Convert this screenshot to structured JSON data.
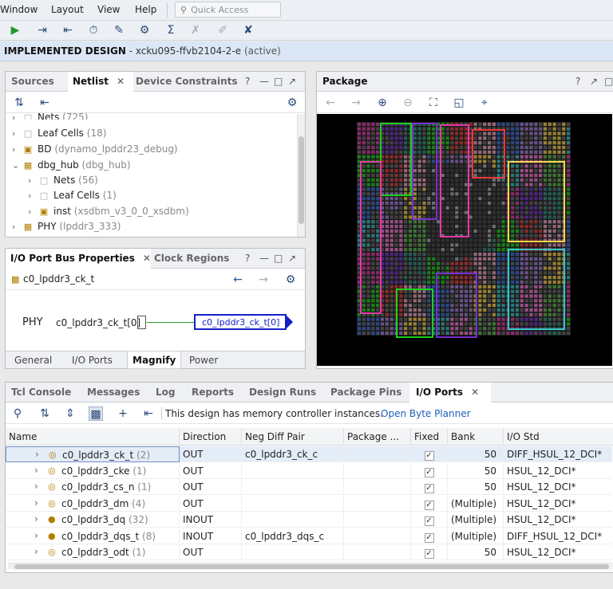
{
  "menubar": {
    "items": [
      "Window",
      "Layout",
      "View",
      "Help"
    ],
    "quick_access_placeholder": "Quick Access"
  },
  "design_bar": {
    "title": "IMPLEMENTED DESIGN",
    "part": " - xcku095-ffvb2104-2-e",
    "state": "(active)"
  },
  "netlist_panel": {
    "tabs": [
      "Sources",
      "Netlist",
      "Device Constraints"
    ],
    "tree": [
      {
        "label": "Nets",
        "extra": "(725)"
      },
      {
        "label": "Leaf Cells",
        "extra": "(18)"
      },
      {
        "label": "BD",
        "extra": "(dynamo_lpddr23_debug)"
      },
      {
        "label": "dbg_hub",
        "extra": "(dbg_hub)"
      },
      {
        "label": "Nets",
        "extra": "(56)"
      },
      {
        "label": "Leaf Cells",
        "extra": "(1)"
      },
      {
        "label": "inst",
        "extra": "(xsdbm_v3_0_0_xsdbm)"
      },
      {
        "label": "PHY",
        "extra": "(lpddr3_333)"
      }
    ]
  },
  "bus_panel": {
    "tabs": [
      "I/O Port Bus Properties",
      "Clock Regions"
    ],
    "selected": "c0_lpddr3_ck_t",
    "schematic": {
      "cell": "PHY",
      "pin": "c0_lpddr3_ck_t[0]",
      "port": "c0_lpddr3_ck_t[0]"
    },
    "bottom_tabs": [
      "General",
      "I/O Ports",
      "Magnify",
      "Power"
    ]
  },
  "package_panel": {
    "title": "Package"
  },
  "bottom_panel": {
    "tabs": [
      "Tcl Console",
      "Messages",
      "Log",
      "Reports",
      "Design Runs",
      "Package Pins",
      "I/O Ports"
    ],
    "info_text": "This design has memory controller instances.",
    "link_text": "Open Byte Planner",
    "columns": [
      "Name",
      "Direction",
      "Neg Diff Pair",
      "Package ...",
      "Fixed",
      "Bank",
      "I/O Std"
    ],
    "rows": [
      {
        "name": "c0_lpddr3_ck_t",
        "count": "(2)",
        "direction": "OUT",
        "neg": "c0_lpddr3_ck_c",
        "fixed": "✓",
        "bank": "50",
        "iostd": "DIFF_HSUL_12_DCI*"
      },
      {
        "name": "c0_lpddr3_cke",
        "count": "(1)",
        "direction": "OUT",
        "neg": "",
        "fixed": "✓",
        "bank": "50",
        "iostd": "HSUL_12_DCI*"
      },
      {
        "name": "c0_lpddr3_cs_n",
        "count": "(1)",
        "direction": "OUT",
        "neg": "",
        "fixed": "✓",
        "bank": "50",
        "iostd": "HSUL_12_DCI*"
      },
      {
        "name": "c0_lpddr3_dm",
        "count": "(4)",
        "direction": "OUT",
        "neg": "",
        "fixed": "✓",
        "bank": "(Multiple)",
        "iostd": "HSUL_12_DCI*"
      },
      {
        "name": "c0_lpddr3_dq",
        "count": "(32)",
        "direction": "INOUT",
        "neg": "",
        "fixed": "✓",
        "bank": "(Multiple)",
        "iostd": "HSUL_12_DCI*"
      },
      {
        "name": "c0_lpddr3_dqs_t",
        "count": "(8)",
        "direction": "INOUT",
        "neg": "c0_lpddr3_dqs_c",
        "fixed": "✓",
        "bank": "(Multiple)",
        "iostd": "DIFF_HSUL_12_DCI*"
      },
      {
        "name": "c0_lpddr3_odt",
        "count": "(1)",
        "direction": "OUT",
        "neg": "",
        "fixed": "✓",
        "bank": "50",
        "iostd": "HSUL_12_DCI*"
      }
    ]
  }
}
